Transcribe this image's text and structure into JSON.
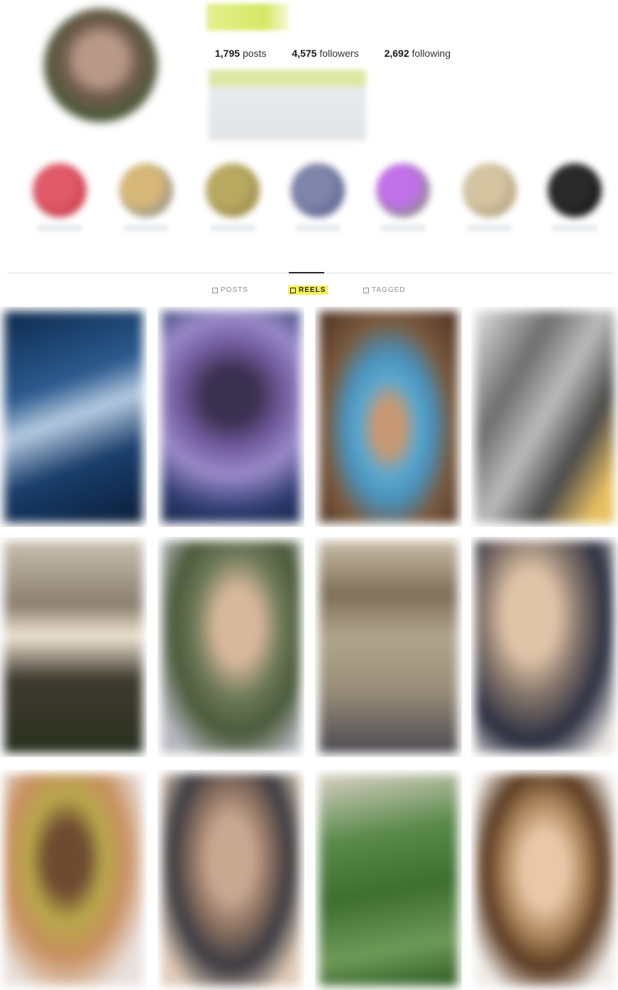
{
  "profile": {
    "avatar_icon": "profile-avatar",
    "stats": [
      {
        "value": "1,795",
        "label": "posts"
      },
      {
        "value": "4,575",
        "label": "followers"
      },
      {
        "value": "2,692",
        "label": "following"
      }
    ]
  },
  "highlights": [
    {
      "color_a": "#e05a68",
      "color_b": "#b8323e"
    },
    {
      "color_a": "#d8b878",
      "color_b": "#6e7e98"
    },
    {
      "color_a": "#b8a860",
      "color_b": "#8a7c3c"
    },
    {
      "color_a": "#7e84aa",
      "color_b": "#4c5280"
    },
    {
      "color_a": "#c070e8",
      "color_b": "#6ea050"
    },
    {
      "color_a": "#d4c4a0",
      "color_b": "#9e8c6a"
    },
    {
      "color_a": "#2a2a2a",
      "color_b": "#101010"
    }
  ],
  "tabs": [
    {
      "label": "POSTS",
      "icon": "grid-icon",
      "active": false
    },
    {
      "label": "REELS",
      "icon": "reels-icon",
      "active": true
    },
    {
      "label": "TAGGED",
      "icon": "tag-icon",
      "active": false
    }
  ],
  "colors": {
    "highlight_yellow": "#f4f05a",
    "text": "#262626",
    "muted": "#8e8e8e"
  },
  "reels": [
    {
      "bg": "linear-gradient(160deg,#0d2a4e 0%,#2c5a8e 35%,#b8cce2 50%,#1a3e6a 70%,#0a1e3a 100%)"
    },
    {
      "bg": "radial-gradient(circle at 50% 40%,#3a3050 0 18%,#6e5a9a 35%,#9a8ac8 55%,#2e3a6e 80%,#1a2a50 100%)"
    },
    {
      "bg": "radial-gradient(ellipse at 50% 55%,#c89872 0 15%,#5aa8d0 30%,#4a90b8 45%,#7a5a3e 65%,#4a3020 100%)"
    },
    {
      "bg": "linear-gradient(120deg,#e0e0e0 0%,#6e6e6e 30%,#bcbcbc 50%,#4a4a4a 70%,#e8c060 90%)"
    },
    {
      "bg": "linear-gradient(180deg,#c8c0b0 0%,#8a7e6e 30%,#f0e6d4 45%,#3e3a30 65%,#2a3020 100%)"
    },
    {
      "bg": "radial-gradient(ellipse at 55% 40%,#d8b89a 0 20%,#6e7a5a 40%,#4a5a3a 60%,#b8b8c0 85%)"
    },
    {
      "bg": "linear-gradient(180deg,#c8bca8 0%,#7e6e58 25%,#b0a48e 45%,#9a8e7a 70%,#4a4a50 100%)"
    },
    {
      "bg": "radial-gradient(ellipse at 40% 35%,#e0c4a8 0 22%,#8a7a6e 40%,#2a2e40 65%,#e8e4e0 90%)"
    },
    {
      "bg": "radial-gradient(ellipse at 45% 40%,#6e4a30 0 18%,#b8a84a 35%,#c89060 55%,#e8e0dc 80%)"
    },
    {
      "bg": "radial-gradient(ellipse at 50% 40%,#c8a890 0 22%,#8a7060 40%,#3a3a40 60%,#e0ccb8 85%)"
    },
    {
      "bg": "linear-gradient(170deg,#d8d0c4 0%,#5a8a4a 30%,#3e6e30 55%,#6e9a5a 80%,#2e5a22 100%)"
    },
    {
      "bg": "radial-gradient(ellipse at 50% 45%,#e8c8a8 0 22%,#b08a60 40%,#5a3a20 60%,#f0ece8 85%)"
    }
  ]
}
